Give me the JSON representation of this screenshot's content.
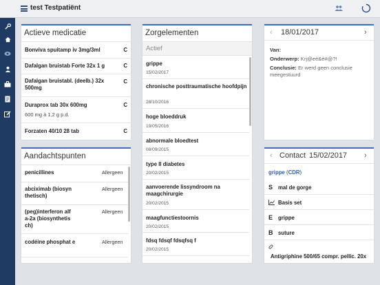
{
  "header": {
    "title": "test Testpatiënt"
  },
  "sidebar": {
    "icons": [
      "wrench-icon",
      "home-icon",
      "eye-icon",
      "user-icon",
      "briefcase-icon",
      "document-icon",
      "edit-icon"
    ]
  },
  "medication": {
    "title": "Actieve medicatie",
    "items": [
      {
        "name": "Bonviva spuitamp iv 3mg/3ml",
        "flag": "C"
      },
      {
        "name": "Dafalgan bruistab Forte 32x 1 g",
        "flag": "C"
      },
      {
        "name": "Dafalgan bruistabl. (deelb.) 32x 500mg",
        "flag": "C"
      },
      {
        "name": "Duraprox tab 30x 600mg",
        "flag": "C",
        "dose": "600 mg à 1,2 g p.d."
      },
      {
        "name": "Forzaten 40/10 28 tab",
        "flag": "C"
      }
    ]
  },
  "attention": {
    "title": "Aandachtspunten",
    "items": [
      {
        "name": "penicillines",
        "type": "Allergeen"
      },
      {
        "name": "abciximab (biosyn thetisch)",
        "type": "Allergeen"
      },
      {
        "name": "(peg)interferon alf a-2a (biosynthetis ch)",
        "type": "Allergeen"
      },
      {
        "name": "codéine phosphat e",
        "type": "Allergeen"
      }
    ]
  },
  "care": {
    "title": "Zorgelementen",
    "section": "Actief",
    "items": [
      {
        "title": "grippe",
        "date": "15/02/2017"
      },
      {
        "title": "chronische posttraumatische hoofdpijn",
        "date": "28/10/2016"
      },
      {
        "title": "hoge bloeddruk",
        "date": "19/05/2016"
      },
      {
        "title": "abnormale bloedtest",
        "date": "08/09/2015"
      },
      {
        "title": "type II diabetes",
        "date": "20/02/2015"
      },
      {
        "title": "aanvoerende lissyndroom na maagchirurgie",
        "date": "20/02/2015"
      },
      {
        "title": "maagfunctiestoornis",
        "date": "20/02/2015"
      },
      {
        "title": "fdsq fdsqf fdsqfsq f",
        "date": "20/02/2015"
      }
    ]
  },
  "note": {
    "date": "18/01/2017",
    "van_label": "Van:",
    "subject_label": "Onderwerp:",
    "subject_value": "Krj@eè&é#@?!",
    "conclusion_label": "Conclusie:",
    "conclusion_value": "Er werd geen conclusie meegestuurd"
  },
  "contact": {
    "label": "Contact",
    "date": "15/02/2017",
    "diagnosis": "grippe",
    "diagnosis_code": "CDR",
    "items": [
      {
        "badge": "S",
        "text": "mal de gorge"
      },
      {
        "badge": "chart",
        "text": "Basis set"
      },
      {
        "badge": "E",
        "text": "grippe"
      },
      {
        "badge": "B",
        "text": "suture"
      },
      {
        "badge": "pill",
        "text": "Antigriphine 500/65 compr. pellic. 20x"
      }
    ]
  }
}
